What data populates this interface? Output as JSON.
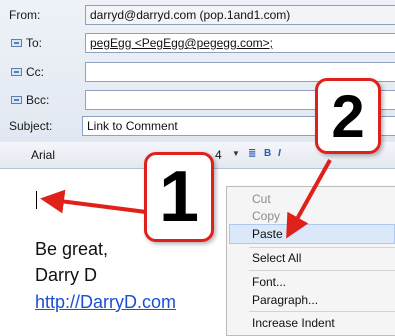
{
  "compose": {
    "from_label": "From:",
    "from_value": "darryd@darryd.com     (pop.1and1.com)",
    "to_label": "To:",
    "to_value": "pegEgg <PegEgg@pegegg.com>;",
    "cc_label": "Cc:",
    "cc_value": "",
    "bcc_label": "Bcc:",
    "bcc_value": "",
    "subject_label": "Subject:",
    "subject_value": "Link to Comment"
  },
  "format_toolbar": {
    "font_name": "Arial",
    "font_size": "4"
  },
  "editor": {
    "signature_line1": "Be great,",
    "signature_line2": "Darry D",
    "signature_link": "http://DarryD.com"
  },
  "context_menu": {
    "cut": "Cut",
    "copy": "Copy",
    "paste": "Paste",
    "select_all": "Select All",
    "font": "Font...",
    "paragraph": "Paragraph...",
    "increase_indent": "Increase Indent"
  },
  "callouts": {
    "one": "1",
    "two": "2"
  },
  "colors": {
    "annotation_red": "#e0201a",
    "link_blue": "#1b4fd6",
    "highlight": "#dbe8fa"
  }
}
